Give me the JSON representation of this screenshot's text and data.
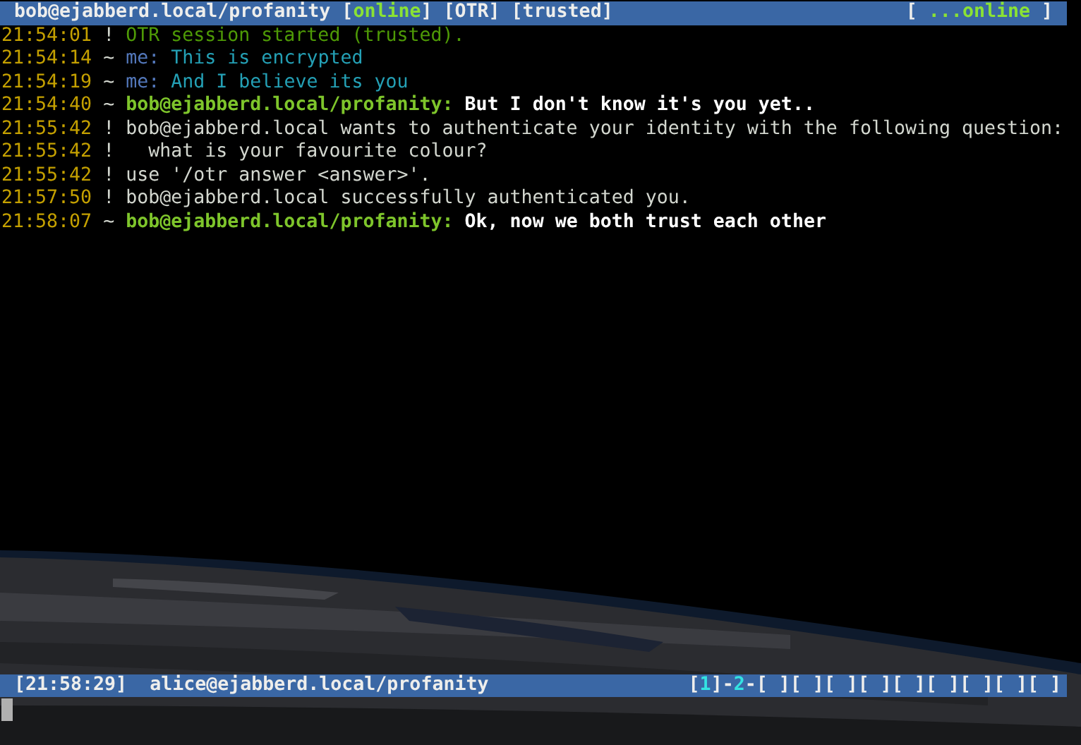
{
  "title_bar": {
    "left": [
      {
        "text": "bob@ejabberd.local/profanity ",
        "kind": "plain"
      },
      {
        "text": "[",
        "kind": "plain"
      },
      {
        "text": "online",
        "kind": "presence"
      },
      {
        "text": "] [OTR] [trusted]",
        "kind": "plain"
      }
    ],
    "right": [
      {
        "text": "[ ",
        "kind": "plain"
      },
      {
        "text": "...online",
        "kind": "presence"
      },
      {
        "text": " ]",
        "kind": "plain"
      }
    ]
  },
  "messages": [
    {
      "time": "21:54:01",
      "marker": "!",
      "kind": "otr",
      "text": "OTR session started (trusted)."
    },
    {
      "time": "21:54:14",
      "marker": "~",
      "kind": "outgoing",
      "sender": "me:",
      "text": "This is encrypted"
    },
    {
      "time": "21:54:19",
      "marker": "~",
      "kind": "outgoing",
      "sender": "me:",
      "text": "And I believe its you"
    },
    {
      "time": "21:54:40",
      "marker": "~",
      "kind": "incoming",
      "sender": "bob@ejabberd.local/profanity:",
      "text": "But I don't know it's you yet.."
    },
    {
      "time": "21:55:42",
      "marker": "!",
      "kind": "info",
      "text": "bob@ejabberd.local wants to authenticate your identity with the following question:"
    },
    {
      "time": "21:55:42",
      "marker": "!",
      "kind": "info",
      "text": "  what is your favourite colour?"
    },
    {
      "time": "21:55:42",
      "marker": "!",
      "kind": "info",
      "text": "use '/otr answer <answer>'."
    },
    {
      "time": "21:57:50",
      "marker": "!",
      "kind": "info",
      "text": "bob@ejabberd.local successfully authenticated you."
    },
    {
      "time": "21:58:07",
      "marker": "~",
      "kind": "incoming",
      "sender": "bob@ejabberd.local/profanity:",
      "text": "Ok, now we both trust each other"
    }
  ],
  "status_bar": {
    "time": "[21:58:29]",
    "account": "alice@ejabberd.local/profanity",
    "windows": [
      {
        "text": "[",
        "kind": "plain"
      },
      {
        "text": "1",
        "kind": "number"
      },
      {
        "text": "]-",
        "kind": "plain"
      },
      {
        "text": "2",
        "kind": "number"
      },
      {
        "text": "-[ ][ ][ ][ ][ ][ ][ ][ ][ ]",
        "kind": "plain"
      }
    ]
  }
}
